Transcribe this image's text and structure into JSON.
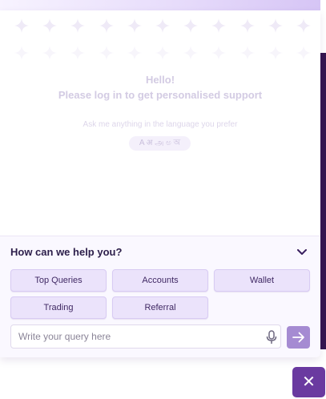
{
  "welcome": {
    "greeting": "Hello!",
    "subtitle": "Please log in to get personalised support",
    "language_prompt": "Ask me anything in the language you prefer",
    "language_chip": "A अ அ ಅ অ"
  },
  "help": {
    "title": "How can we help you?",
    "categories": [
      {
        "label": "Top Queries"
      },
      {
        "label": "Accounts"
      },
      {
        "label": "Wallet"
      },
      {
        "label": "Trading"
      },
      {
        "label": "Referral"
      }
    ]
  },
  "composer": {
    "placeholder": "Write your query here",
    "value": ""
  },
  "icons": {
    "chevron": "chevron-down-icon",
    "mic": "microphone-icon",
    "send": "arrow-right-icon",
    "close": "close-icon",
    "decor": "sparkle-icon"
  },
  "colors": {
    "accent": "#6a3aa0",
    "send_button": "#a58bd2",
    "chip_fill": "#ebe3fb",
    "title_text": "#2c1e4a",
    "right_edge": "#35164f"
  },
  "close_glyph": "✕"
}
